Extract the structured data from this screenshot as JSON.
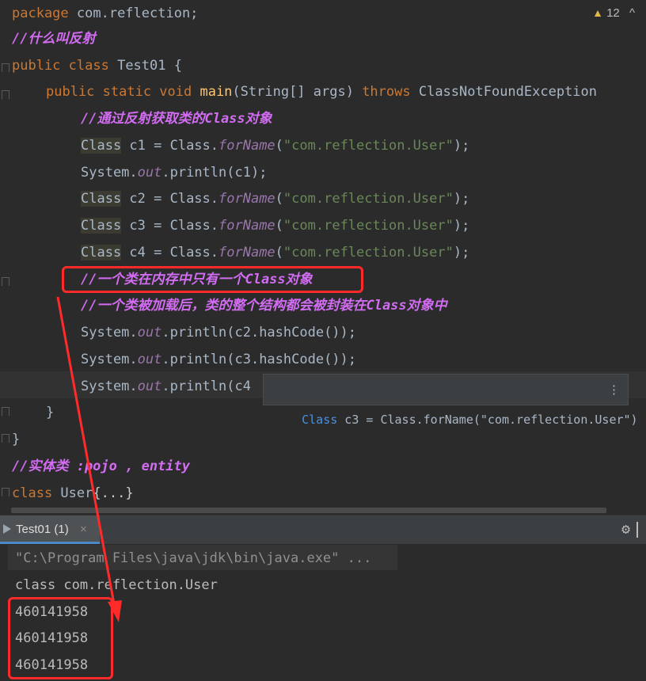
{
  "editor": {
    "warning_count": "12",
    "lines": {
      "l1": {
        "kw": "package",
        "rest": " com.reflection;"
      },
      "l2": {
        "comment": "//什么叫反射"
      },
      "l3": {
        "kw1": "public",
        "kw2": " class",
        "name": " Test01 {"
      },
      "l4": {
        "kw": "public static void",
        "fn": " main",
        "args": "(String[] args) ",
        "throws": "throws",
        "exc": " ClassNotFoundException"
      },
      "l5": {
        "comment": "//通过反射获取类的Class对象"
      },
      "l6": {
        "cls": "Class",
        "mid": " c1 = Class.",
        "method": "forName",
        "open": "(",
        "str": "\"com.reflection.User\"",
        "close": ");"
      },
      "l7": {
        "pre": "System.",
        "field": "out",
        "post": ".println(c1);"
      },
      "l8": {
        "cls": "Class",
        "mid": " c2 = Class.",
        "method": "forName",
        "open": "(",
        "str": "\"com.reflection.User\"",
        "close": ");"
      },
      "l9": {
        "cls": "Class",
        "mid": " c3 = Class.",
        "method": "forName",
        "open": "(",
        "str": "\"com.reflection.User\"",
        "close": ");"
      },
      "l10": {
        "cls": "Class",
        "mid": " c4 = Class.",
        "method": "forName",
        "open": "(",
        "str": "\"com.reflection.User\"",
        "close": ");"
      },
      "l11": {
        "comment": "//一个类在内存中只有一个Class对象"
      },
      "l12": {
        "comment": "//一个类被加载后，类的整个结构都会被封装在Class对象中"
      },
      "l13": {
        "pre": "System.",
        "field": "out",
        "post": ".println(c2.hashCode());"
      },
      "l14": {
        "pre": "System.",
        "field": "out",
        "post": ".println(c3.hashCode());"
      },
      "l15": {
        "pre": "System.",
        "field": "out",
        "post": ".println(c4"
      },
      "l16": {
        "text": "}"
      },
      "l17": {
        "text": "}"
      },
      "l18": {
        "comment": "//实体类 :pojo , entity"
      },
      "l19": {
        "kw": "class",
        "name": " User",
        "fold": "{...}"
      }
    },
    "tooltip": {
      "kw": "Class",
      "text": " c3 = Class.forName(\"com.reflection.User\")",
      "more": "⋮"
    }
  },
  "run_panel": {
    "tab_label": "Test01 (1)",
    "tab_close": "×",
    "settings_icon": "⚙",
    "command": "\"C:\\Program Files\\java\\jdk\\bin\\java.exe\" ...",
    "output": [
      "class com.reflection.User",
      "460141958",
      "460141958",
      "460141958"
    ]
  },
  "colors": {
    "annotation": "#ff2b2b",
    "keyword": "#cc7832",
    "string": "#6a8759",
    "comment": "#d26cf2"
  }
}
